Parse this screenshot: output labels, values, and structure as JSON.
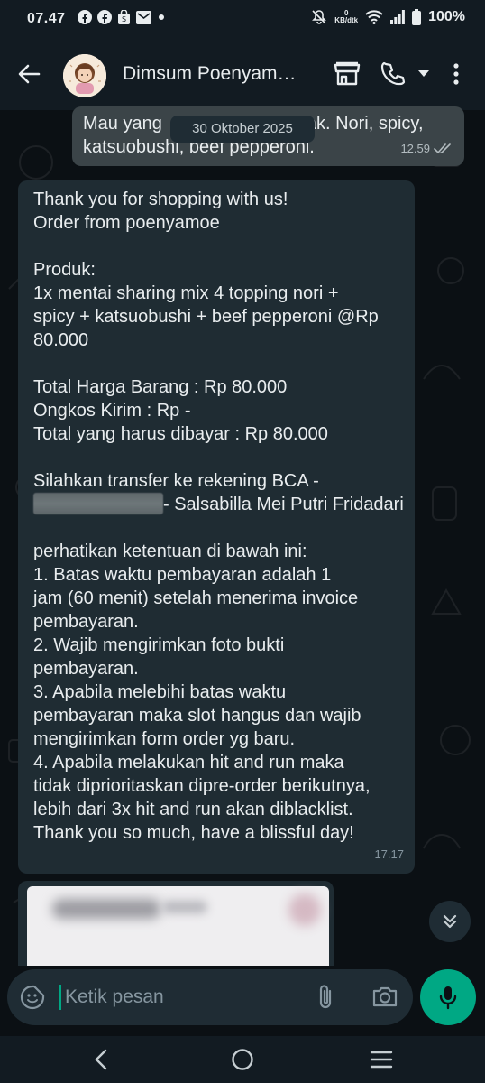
{
  "status_bar": {
    "time": "07.47",
    "net_speed_value": "0",
    "net_speed_unit": "KB/dtk",
    "battery": "100%"
  },
  "header": {
    "contact_name": "Dimsum Poenyam…",
    "icons": [
      "back-arrow-icon",
      "store-icon",
      "phone-icon",
      "caret-down-icon",
      "more-vert-icon"
    ]
  },
  "messages": {
    "outgoing": {
      "text_line1": "Mau yang",
      "text_line1_end": "ak. Nori, spicy,",
      "text_line2": "katsuobushi, beef pepperoni.",
      "time": "12.59",
      "status": "read"
    },
    "date_divider": "30 Oktober 2025",
    "incoming": {
      "lines": [
        "Thank you for shopping with us!",
        "Order from poenyamoe",
        "",
        "Produk:",
        "1x mentai sharing mix 4 topping nori +",
        "spicy + katsuobushi + beef pepperoni @Rp",
        "80.000",
        "",
        "Total Harga Barang : Rp 80.000",
        "Ongkos Kirim : Rp -",
        "Total yang harus dibayar : Rp 80.000",
        "",
        "Silahkan transfer ke rekening BCA -"
      ],
      "account_line_suffix": "- Salsabilla Mei Putri Fridadari",
      "lines2": [
        "",
        " perhatikan ketentuan di bawah ini:",
        "1. Batas waktu pembayaran adalah 1",
        "jam (60 menit) setelah menerima invoice",
        "pembayaran.",
        "2. Wajib mengirimkan foto bukti",
        "pembayaran.",
        "3. Apabila melebihi batas waktu",
        "pembayaran maka slot hangus dan wajib",
        "mengirimkan form order yg baru.",
        "4. Apabila melakukan hit and run maka",
        "tidak diprioritaskan dipre-order berikutnya,",
        "lebih dari 3x hit and run akan diblacklist.",
        "Thank you so much, have a blissful day!"
      ],
      "time": "17.17"
    }
  },
  "composer": {
    "placeholder": "Ketik pesan"
  },
  "colors": {
    "accent": "#00a884",
    "bubble_incoming": "#1f2c33",
    "bubble_outgoing": "#3b4448",
    "background": "#0b1014"
  }
}
